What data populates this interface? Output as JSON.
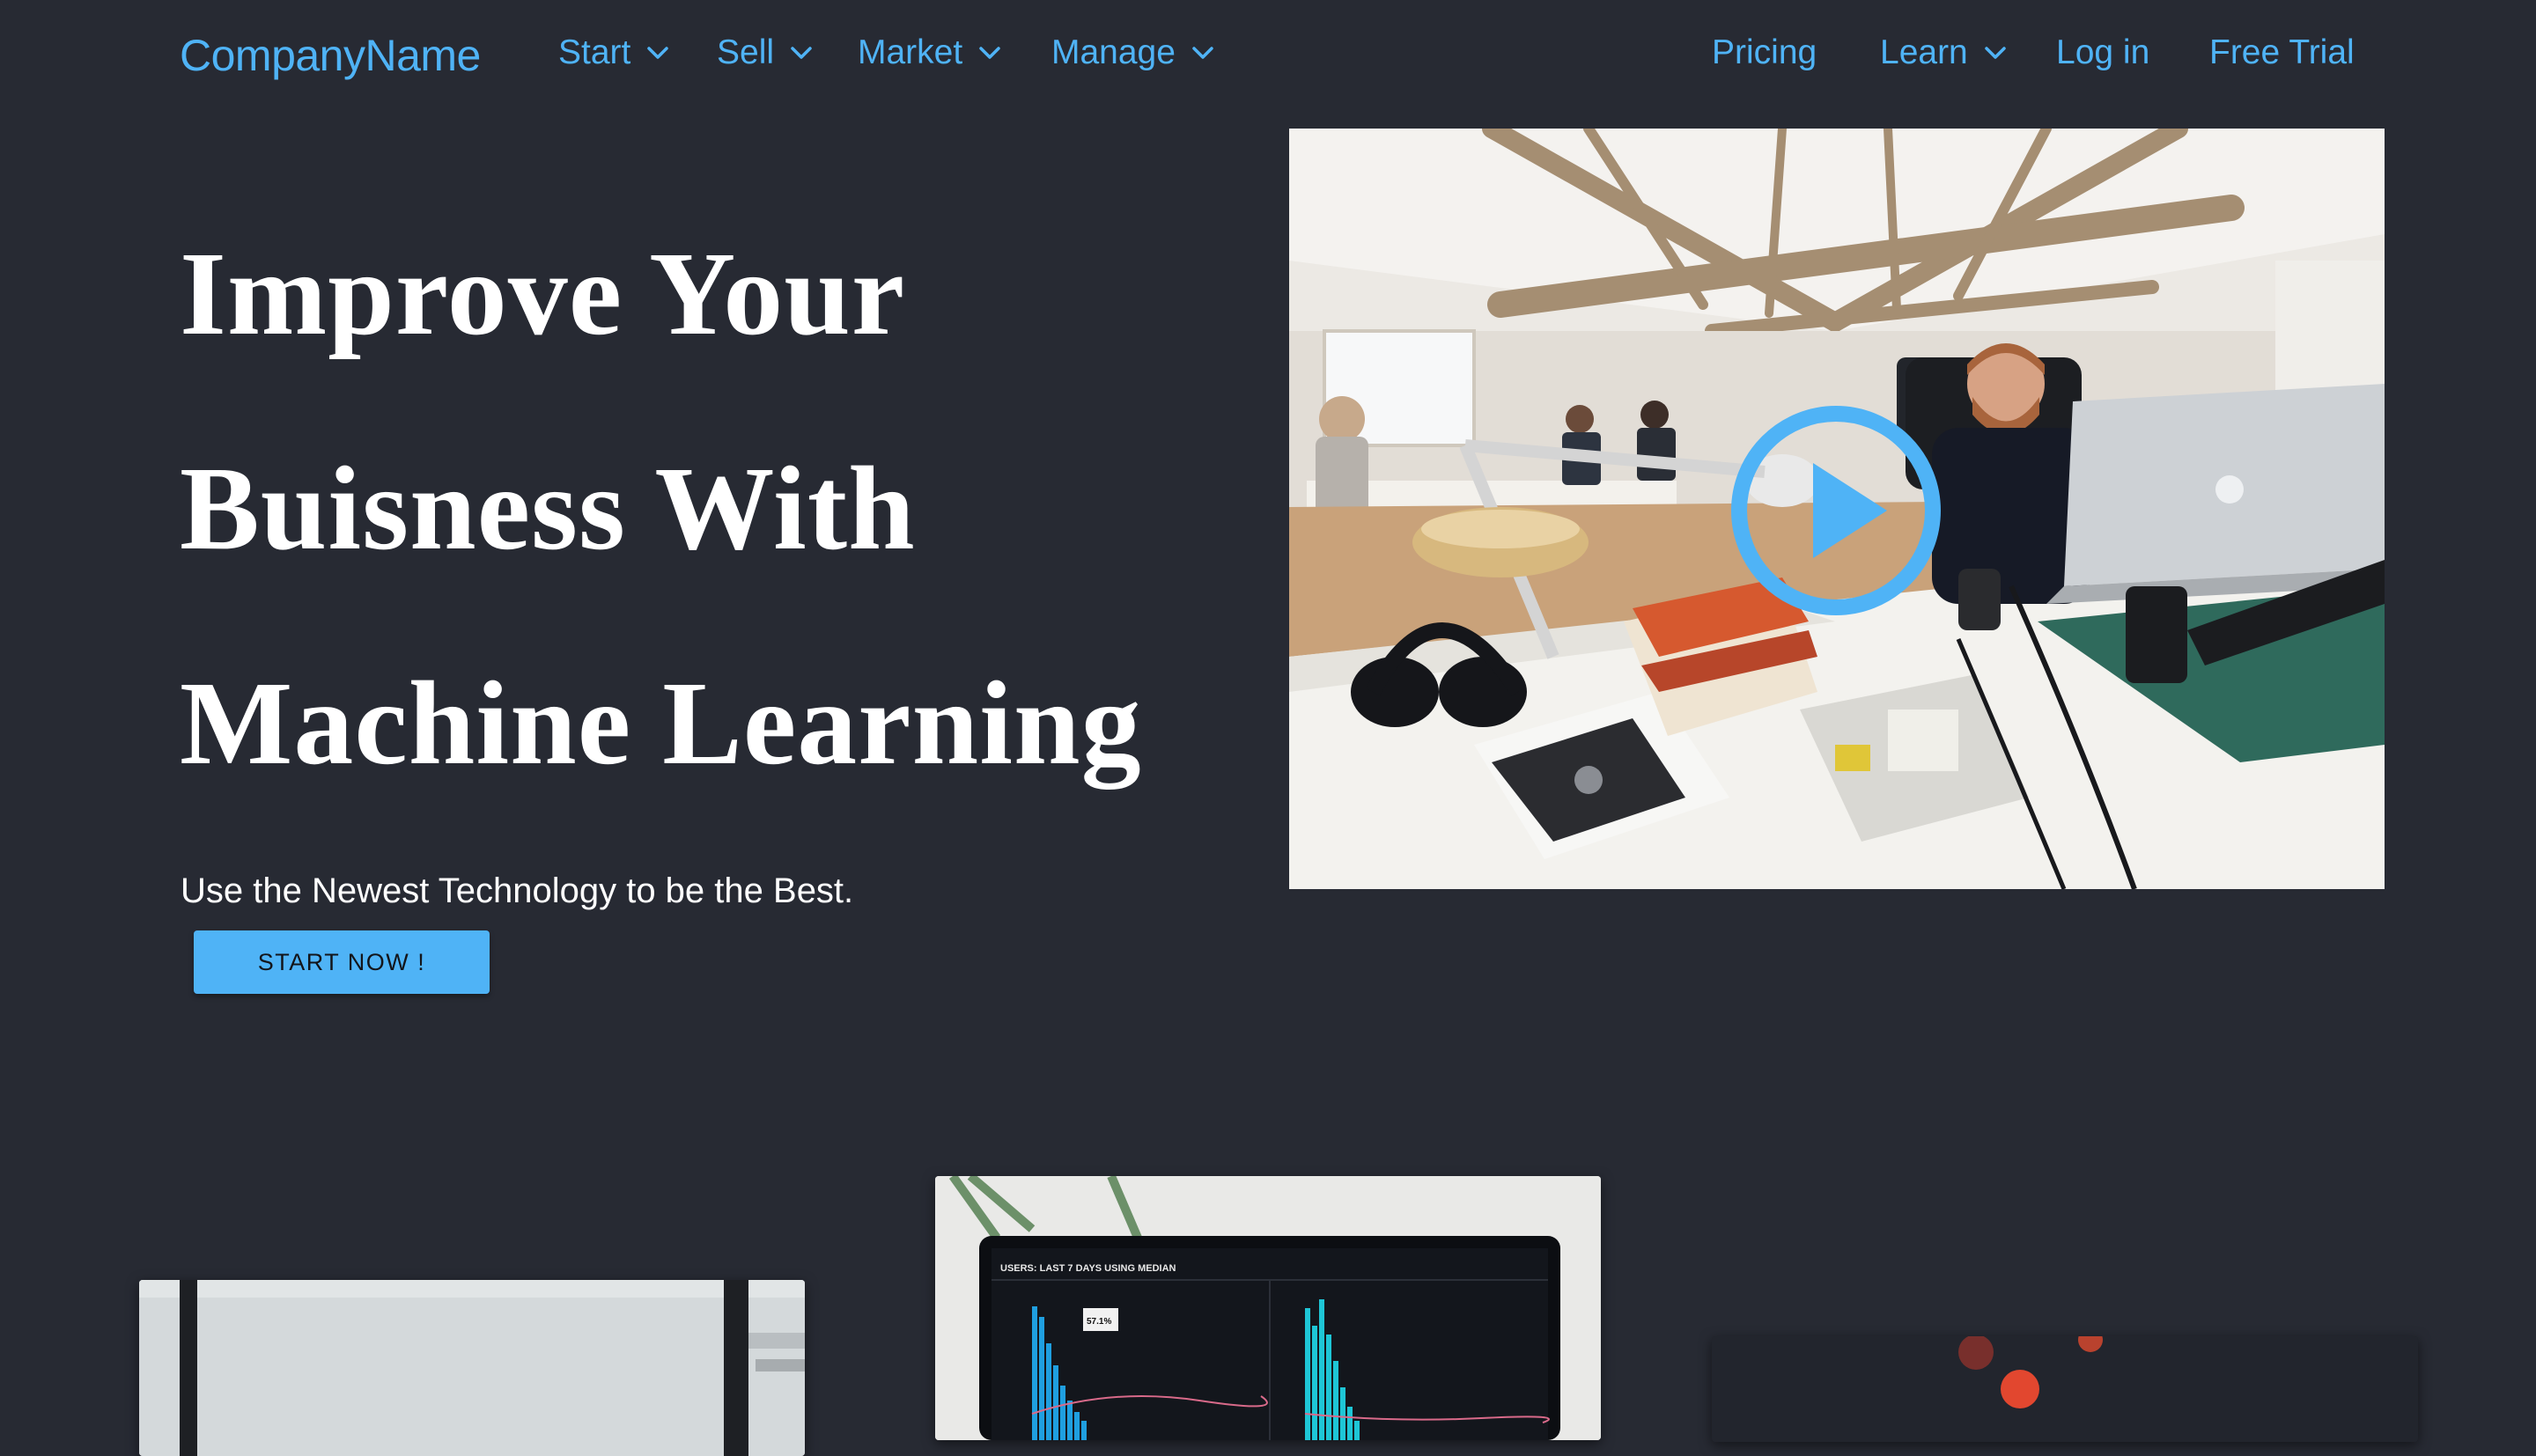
{
  "nav": {
    "brand": "CompanyName",
    "menu": [
      {
        "label": "Start"
      },
      {
        "label": "Sell"
      },
      {
        "label": "Market"
      },
      {
        "label": "Manage"
      }
    ],
    "right": {
      "pricing": "Pricing",
      "learn": "Learn",
      "login": "Log in",
      "trial": "Free Trial"
    }
  },
  "hero": {
    "title_lines": [
      "Improve Your",
      "Buisness With",
      "Machine Learning"
    ],
    "subtitle": "Use the Newest Technology to be the Best.",
    "cta_label": "START NOW !"
  },
  "video": {
    "icon": "play-icon"
  },
  "dashboard_card": {
    "header": "USERS: LAST 7 DAYS USING MEDIAN",
    "tooltip": "57.1%"
  },
  "colors": {
    "background": "#272a33",
    "accent": "#4fb3f6",
    "text": "#ffffff"
  }
}
